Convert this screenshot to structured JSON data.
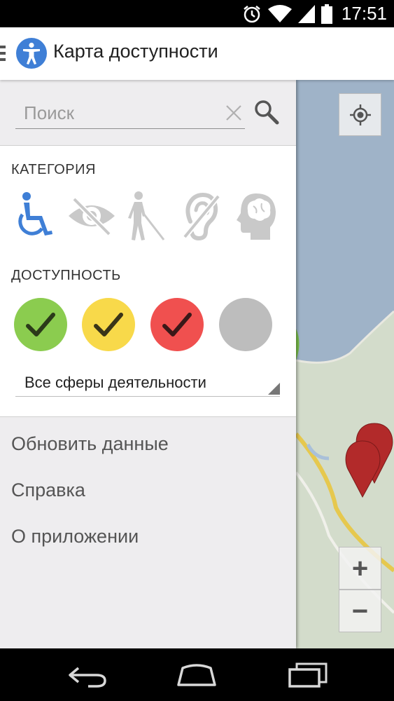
{
  "status_bar": {
    "time": "17:51",
    "icons": [
      "alarm-icon",
      "wifi-icon",
      "signal-icon",
      "battery-icon"
    ]
  },
  "app_bar": {
    "title": "Карта доступности",
    "logo_icon": "accessibility-person-icon",
    "menu_icon": "hamburger-icon"
  },
  "drawer": {
    "search": {
      "value": "",
      "placeholder": "Поиск"
    },
    "category": {
      "label": "КАТЕГОРИЯ",
      "items": [
        {
          "name": "wheelchair",
          "icon": "wheelchair-icon",
          "selected": true
        },
        {
          "name": "vision",
          "icon": "eye-crossed-icon",
          "selected": false
        },
        {
          "name": "blind-cane",
          "icon": "blind-person-cane-icon",
          "selected": false
        },
        {
          "name": "hearing",
          "icon": "ear-crossed-icon",
          "selected": false
        },
        {
          "name": "mental",
          "icon": "head-brain-icon",
          "selected": false
        }
      ]
    },
    "accessibility": {
      "label": "ДОСТУПНОСТЬ",
      "items": [
        {
          "name": "full",
          "color": "#8bcc4f",
          "checked": true
        },
        {
          "name": "partial",
          "color": "#f8d94a",
          "checked": true
        },
        {
          "name": "none",
          "color": "#f0504f",
          "checked": true
        },
        {
          "name": "unknown",
          "color": "#bdbdbd",
          "checked": false
        }
      ]
    },
    "sphere_select": {
      "value": "Все сферы деятельности"
    },
    "menu": {
      "refresh": "Обновить данные",
      "help": "Справка",
      "about": "О приложении"
    }
  },
  "map": {
    "controls": {
      "zoom_in": "+",
      "zoom_out": "−"
    },
    "marker_color": "#b22a2a"
  },
  "colors": {
    "accent_blue": "#3f7fd6",
    "icon_gray": "#c9c9c9",
    "drawer_bg": "#eeedef"
  }
}
